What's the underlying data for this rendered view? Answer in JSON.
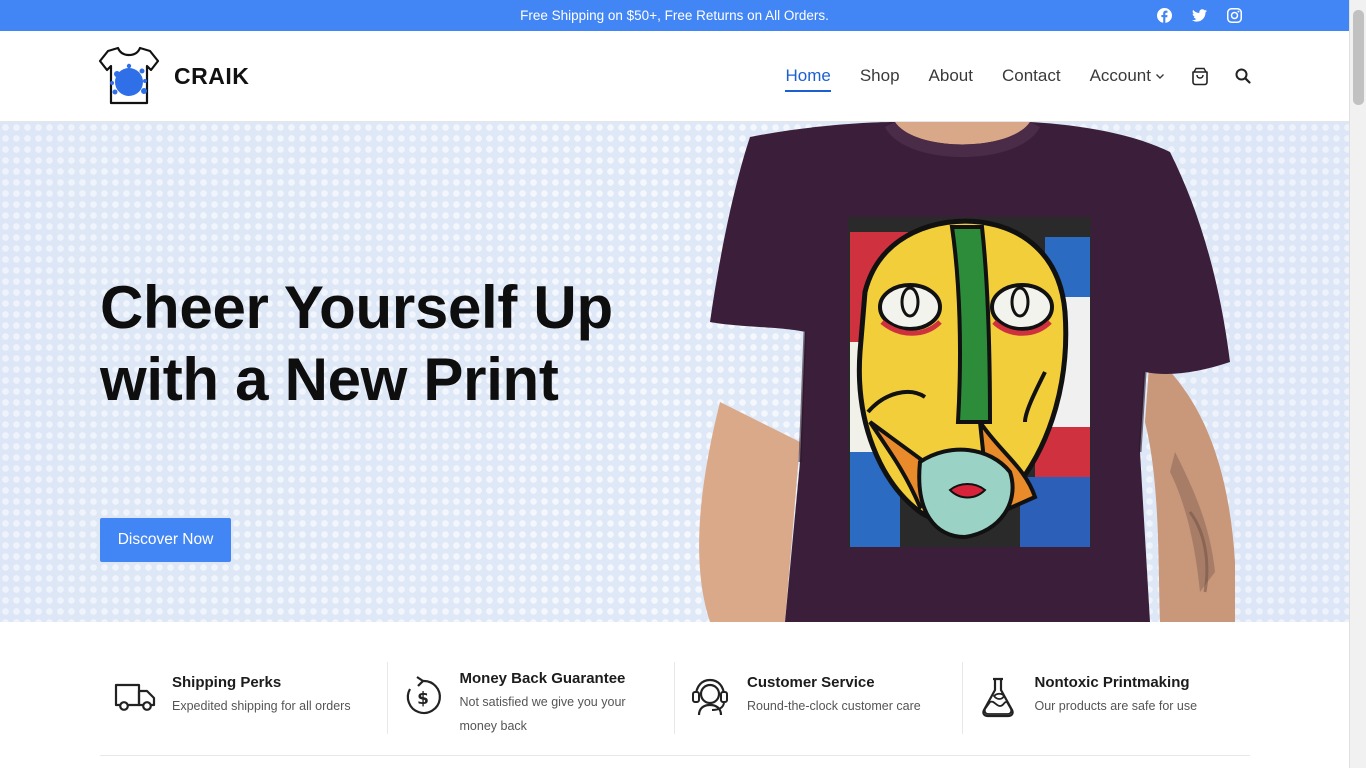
{
  "topbar": {
    "promo": "Free Shipping on $50+, Free Returns on All Orders.",
    "social_icons": [
      "facebook-icon",
      "twitter-icon",
      "instagram-icon"
    ]
  },
  "header": {
    "brand": "CRAIK",
    "nav": [
      {
        "label": "Home",
        "active": true
      },
      {
        "label": "Shop"
      },
      {
        "label": "About"
      },
      {
        "label": "Contact"
      },
      {
        "label": "Account",
        "has_dropdown": true
      }
    ],
    "icons": [
      "cart-icon",
      "search-icon"
    ]
  },
  "hero": {
    "headline": "Cheer Yourself Up with a New Print",
    "cta_label": "Discover Now"
  },
  "features": [
    {
      "icon": "truck-icon",
      "title": "Shipping Perks",
      "description": "Expedited shipping for all orders"
    },
    {
      "icon": "money-back-icon",
      "title": "Money Back Guarantee",
      "description": "Not satisfied we give you your money back"
    },
    {
      "icon": "headset-icon",
      "title": "Customer Service",
      "description": "Round-the-clock customer care"
    },
    {
      "icon": "flask-icon",
      "title": "Nontoxic Printmaking",
      "description": "Our products are safe for use"
    }
  ],
  "colors": {
    "accent": "#4285f4",
    "nav_active": "#1c5fd0",
    "hero_bg": "#dfe8f6",
    "shirt": "#3b1f3a"
  }
}
